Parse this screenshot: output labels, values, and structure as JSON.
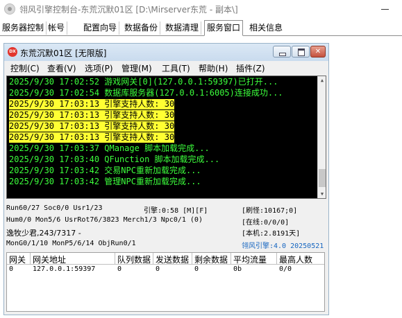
{
  "outer_window": {
    "title": "翎风引擎控制台-东荒沉默01区 [D:\\Mirserver东荒 - 副本\\]"
  },
  "tabs": [
    {
      "label": "服务器控制"
    },
    {
      "label": "帐号"
    },
    {
      "label": "配置向导"
    },
    {
      "label": "数据备份"
    },
    {
      "label": "数据清理"
    },
    {
      "label": "服务窗口",
      "active": true
    },
    {
      "label": "相关信息"
    }
  ],
  "inner_window": {
    "title": "东荒沉默01区 [无限版]",
    "icon_text": "DX",
    "icon_color": "#e2352d",
    "menu": [
      "控制(C)",
      "查看(V)",
      "选项(P)",
      "管理(M)",
      "工具(T)",
      "帮助(H)",
      "插件(Z)"
    ]
  },
  "log": {
    "lines": [
      {
        "text": "2025/9/30  17:02:52  游戏网关[0](127.0.0.1:59397)已打开...",
        "highlight": false
      },
      {
        "text": "2025/9/30  17:02:54  数据库服务器(127.0.0.1:6005)连接成功...",
        "highlight": false
      },
      {
        "text": "2025/9/30  17:03:13  引擎支持人数: 30",
        "highlight": true
      },
      {
        "text": "2025/9/30  17:03:13  引擎支持人数: 30",
        "highlight": true
      },
      {
        "text": "2025/9/30  17:03:13  引擎支持人数: 30",
        "highlight": true
      },
      {
        "text": "2025/9/30  17:03:13  引擎支持人数: 30",
        "highlight": true
      },
      {
        "text": "2025/9/30  17:03:37  QManage 脚本加载完成...",
        "highlight": false
      },
      {
        "text": "2025/9/30  17:03:40  QFunction 脚本加载完成...",
        "highlight": false
      },
      {
        "text": "2025/9/30  17:03:42  交易NPC重新加载完成...",
        "highlight": false
      },
      {
        "text": "2025/9/30  17:03:42  管理NPC重新加载完成...",
        "highlight": false
      }
    ],
    "text_color": "#3cff3c",
    "highlight_color": "#ffff33"
  },
  "status": {
    "run": "Run60/27 Soc0/0 Usr1/23",
    "engine": "引擎:0:58 [M][F]",
    "refresh": "[刷怪:10167;0]",
    "hum": "Hum0/0 Mon5/6 UsrRot76/3823 Merch1/3 Npc0/1 (0)",
    "online": "[在线:0/0/0]",
    "player": "逸牧少君,243/7317 -",
    "machine": "[本机:2.8191天]",
    "mon": "MonG0/1/10 MonP5/6/14 ObjRun0/1",
    "brand": "翎风引擎:4.0 20250521"
  },
  "grid": {
    "columns": [
      "网关",
      "网关地址",
      "队列数据",
      "发送数据",
      "剩余数据",
      "平均流量",
      "最高人数"
    ],
    "rows": [
      [
        "0",
        "127.0.0.1:59397",
        "0",
        "0",
        "0",
        "0b",
        "0/0"
      ]
    ]
  }
}
